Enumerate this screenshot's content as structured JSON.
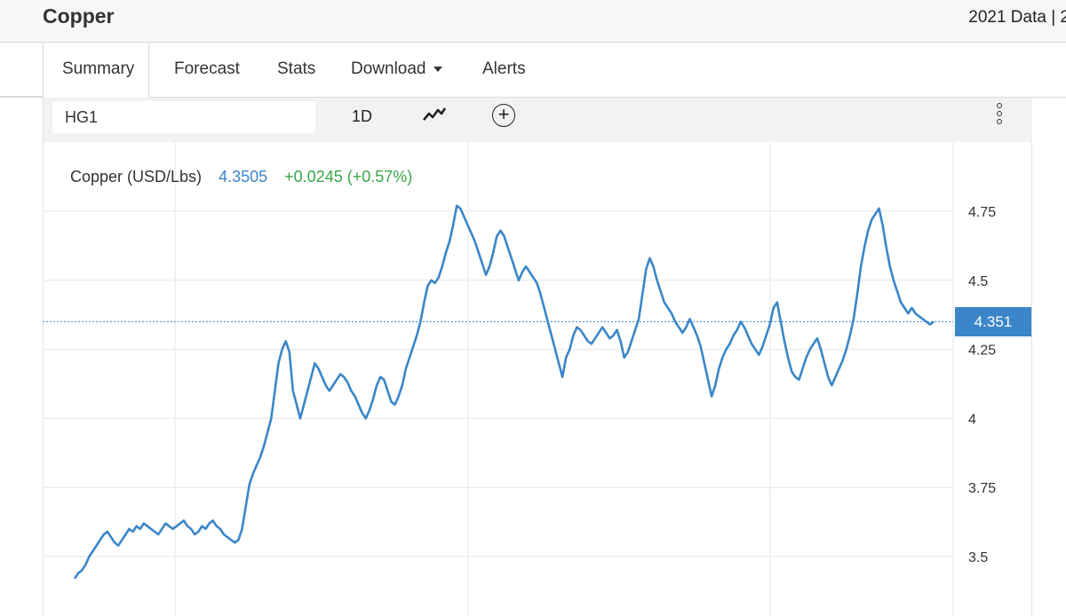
{
  "header": {
    "title": "Copper",
    "data_years": "2021 Data | 2"
  },
  "tabs": [
    {
      "label": "Summary"
    },
    {
      "label": "Forecast"
    },
    {
      "label": "Stats"
    },
    {
      "label": "Download"
    },
    {
      "label": "Alerts"
    }
  ],
  "toolbar": {
    "symbol": "HG1",
    "interval": "1D",
    "line_icon": "line-chart-icon",
    "add_icon": "plus-circle-icon",
    "menu_icon": "kebab-menu-icon"
  },
  "legend": {
    "name": "Copper (USD/Lbs)",
    "price": "4.3505",
    "change": "+0.0245 (+0.57%)"
  },
  "current_badge": "4.351",
  "colors": {
    "line": "#3b86c8",
    "positive": "#3aa64a",
    "badge": "#3b86c8"
  },
  "chart_data": {
    "type": "line",
    "title": "",
    "xlabel": "",
    "ylabel": "",
    "ylim": [
      3.45,
      4.91
    ],
    "yticks": [
      3.5,
      3.75,
      4,
      4.25,
      4.5,
      4.75
    ],
    "ytick_labels": [
      "3.5",
      "3.75",
      "4",
      "4.25",
      "4.5",
      "4.75"
    ],
    "grid": true,
    "last_value": 4.3505,
    "series": [
      {
        "values": [
          3.42,
          3.44,
          3.45,
          3.47,
          3.5,
          3.52,
          3.54,
          3.56,
          3.58,
          3.59,
          3.57,
          3.55,
          3.54,
          3.56,
          3.58,
          3.6,
          3.59,
          3.61,
          3.6,
          3.62,
          3.61,
          3.6,
          3.59,
          3.58,
          3.6,
          3.62,
          3.61,
          3.6,
          3.61,
          3.62,
          3.63,
          3.61,
          3.6,
          3.58,
          3.59,
          3.61,
          3.6,
          3.62,
          3.63,
          3.61,
          3.6,
          3.58,
          3.57,
          3.56,
          3.55,
          3.56,
          3.6,
          3.68,
          3.76,
          3.8,
          3.83,
          3.86,
          3.9,
          3.95,
          4.0,
          4.1,
          4.2,
          4.25,
          4.28,
          4.24,
          4.1,
          4.05,
          4.0,
          4.05,
          4.1,
          4.15,
          4.2,
          4.18,
          4.15,
          4.12,
          4.1,
          4.12,
          4.14,
          4.16,
          4.15,
          4.13,
          4.1,
          4.08,
          4.05,
          4.02,
          4.0,
          4.03,
          4.07,
          4.12,
          4.15,
          4.14,
          4.1,
          4.06,
          4.05,
          4.08,
          4.12,
          4.18,
          4.22,
          4.26,
          4.3,
          4.35,
          4.42,
          4.48,
          4.5,
          4.49,
          4.51,
          4.55,
          4.6,
          4.64,
          4.7,
          4.77,
          4.76,
          4.73,
          4.7,
          4.67,
          4.64,
          4.6,
          4.56,
          4.52,
          4.55,
          4.6,
          4.66,
          4.68,
          4.66,
          4.62,
          4.58,
          4.54,
          4.5,
          4.53,
          4.55,
          4.53,
          4.51,
          4.49,
          4.45,
          4.4,
          4.35,
          4.3,
          4.25,
          4.2,
          4.15,
          4.22,
          4.25,
          4.3,
          4.33,
          4.32,
          4.3,
          4.28,
          4.27,
          4.29,
          4.31,
          4.33,
          4.31,
          4.29,
          4.3,
          4.32,
          4.28,
          4.22,
          4.24,
          4.28,
          4.32,
          4.36,
          4.45,
          4.54,
          4.58,
          4.55,
          4.5,
          4.46,
          4.42,
          4.4,
          4.38,
          4.35,
          4.33,
          4.31,
          4.33,
          4.36,
          4.33,
          4.3,
          4.26,
          4.2,
          4.14,
          4.08,
          4.12,
          4.18,
          4.22,
          4.25,
          4.27,
          4.3,
          4.32,
          4.35,
          4.33,
          4.3,
          4.27,
          4.25,
          4.23,
          4.26,
          4.3,
          4.34,
          4.4,
          4.42,
          4.35,
          4.28,
          4.22,
          4.17,
          4.15,
          4.14,
          4.18,
          4.22,
          4.25,
          4.27,
          4.29,
          4.25,
          4.2,
          4.15,
          4.12,
          4.15,
          4.18,
          4.21,
          4.25,
          4.3,
          4.36,
          4.45,
          4.55,
          4.62,
          4.68,
          4.72,
          4.74,
          4.76,
          4.7,
          4.62,
          4.55,
          4.5,
          4.46,
          4.42,
          4.4,
          4.38,
          4.4,
          4.38,
          4.37,
          4.36,
          4.35,
          4.34,
          4.3505
        ]
      }
    ]
  }
}
